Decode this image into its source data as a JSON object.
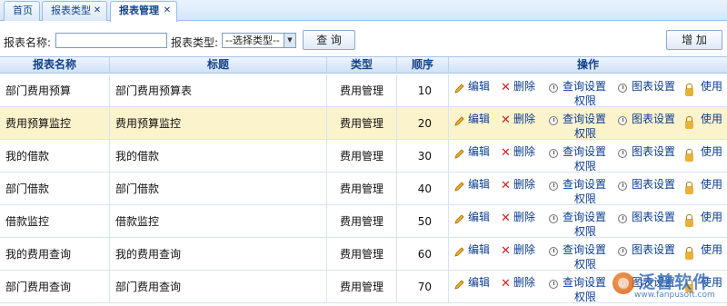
{
  "tabs": [
    {
      "label": "首页",
      "closable": false,
      "active": false
    },
    {
      "label": "报表类型",
      "closable": true,
      "active": false
    },
    {
      "label": "报表管理",
      "closable": true,
      "active": true
    }
  ],
  "search": {
    "name_label": "报表名称:",
    "name_value": "",
    "type_label": "报表类型:",
    "type_selected": "--选择类型--",
    "query_button": "查 询",
    "add_button": "增 加"
  },
  "table": {
    "columns": [
      "报表名称",
      "标题",
      "类型",
      "顺序",
      "操作"
    ],
    "rows": [
      {
        "name": "部门费用预算",
        "title": "部门费用预算表",
        "type": "费用管理",
        "order": "10",
        "selected": false
      },
      {
        "name": "费用预算监控",
        "title": "费用预算监控",
        "type": "费用管理",
        "order": "20",
        "selected": true
      },
      {
        "name": "我的借款",
        "title": "我的借款",
        "type": "费用管理",
        "order": "30",
        "selected": false
      },
      {
        "name": "部门借款",
        "title": "部门借款",
        "type": "费用管理",
        "order": "40",
        "selected": false
      },
      {
        "name": "借款监控",
        "title": "借款监控",
        "type": "费用管理",
        "order": "50",
        "selected": false
      },
      {
        "name": "我的费用查询",
        "title": "我的费用查询",
        "type": "费用管理",
        "order": "60",
        "selected": false
      },
      {
        "name": "部门费用查询",
        "title": "部门费用查询",
        "type": "费用管理",
        "order": "70",
        "selected": false
      }
    ],
    "actions": {
      "edit": "编辑",
      "delete": "删除",
      "query_settings": "查询设置",
      "chart_settings": "图表设置",
      "use": "使用",
      "permission": "权限"
    }
  },
  "watermark": {
    "brand": "泛普软件",
    "url": "www.fanpusoft.com"
  },
  "colors": {
    "accent": "#15428b",
    "selected_row": "#fbf3cc",
    "delete": "#d42020",
    "watermark": "#3a6fb8"
  }
}
